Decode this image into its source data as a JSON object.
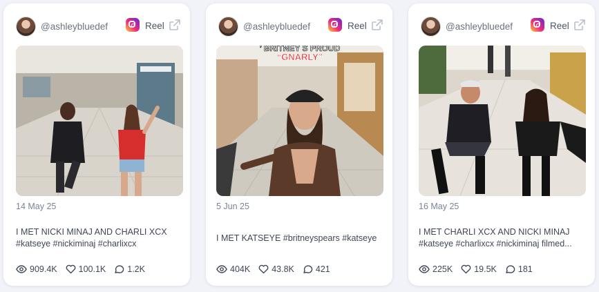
{
  "cards": [
    {
      "username": "@ashleybluedef",
      "platform_label": "Reel",
      "date": "14 May 25",
      "caption_line1": "I MET NICKI MINAJ AND CHARLI XCX",
      "caption_line2": "#katseye #nickiminaj #charlixcx",
      "views": "909.4K",
      "likes": "100.1K",
      "comments": "1.2K"
    },
    {
      "username": "@ashleybluedef",
      "platform_label": "Reel",
      "date": "5 Jun 25",
      "caption_line1": "I MET KATSEYE #britneyspears #katseye",
      "caption_line2": "",
      "views": "404K",
      "likes": "43.8K",
      "comments": "421",
      "thumb_text_line1": "’ BRITNEY S PROUD",
      "thumb_text_line2": "“GNARLY”"
    },
    {
      "username": "@ashleybluedef",
      "platform_label": "Reel",
      "date": "16 May 25",
      "caption_line1": "I MET CHARLI XCX AND NICKI MINAJ",
      "caption_line2": "#katseye #charlixcx #nickiminaj filmed...",
      "views": "225K",
      "likes": "19.5K",
      "comments": "181"
    }
  ],
  "icons": {
    "views": "eye-icon",
    "likes": "heart-icon",
    "comments": "comment-icon",
    "platform": "instagram-icon",
    "open": "external-link-icon"
  },
  "colors": {
    "page_bg": "#f1f3f8",
    "card_bg": "#ffffff",
    "muted_text": "#7b8597",
    "body_text": "#3f4656"
  }
}
